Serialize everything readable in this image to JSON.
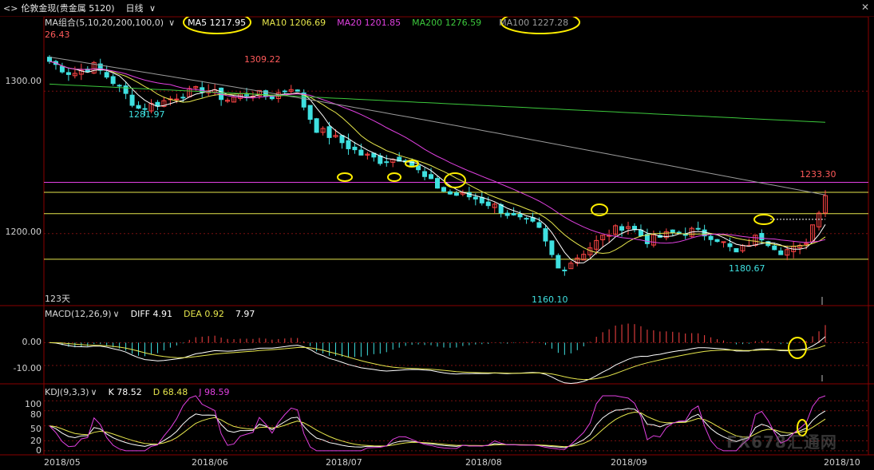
{
  "toolbar": {
    "nav_label": "<>",
    "title": "伦敦金现(贵金属 5120)",
    "period": "日线",
    "close_label": "✕"
  },
  "colors": {
    "background": "#000000",
    "up": "#ff4545",
    "down": "#3fe0e0",
    "ma5": "#ffffff",
    "ma10": "#e6e64c",
    "ma20": "#e040e0",
    "ma100": "#9a9a9a",
    "ma200": "#3cc83c",
    "highlight": "#ffee00",
    "grid": "#7a1010"
  },
  "legends": {
    "main": {
      "label": "MA组合(5,10,20,200,100,0)",
      "ma5": "MA5 1217.95",
      "ma10": "MA10 1206.69",
      "ma20": "MA20 1201.85",
      "ma200": "MA200 1276.59",
      "ma100": "MA100 1227.28"
    },
    "macd": {
      "label": "MACD(12,26,9)",
      "diff": "DIFF 4.91",
      "dea": "DEA 0.92",
      "macd": "7.97"
    },
    "kdj": {
      "label": "KDJ(9,3,3)",
      "k": "K 78.52",
      "d": "D 68.48",
      "j": "J 98.59"
    }
  },
  "annotations": {
    "days": "123天",
    "high_1": "1309.22",
    "low_1": "1281.97",
    "low_2": "1160.10",
    "low_3": "1180.67",
    "high_2": "1233.30",
    "top_left": "26.43"
  },
  "watermark": "FX678汇通网",
  "chart_data": {
    "type": "candlestick",
    "x_ticks": [
      "2018/05",
      "2018/06",
      "2018/07",
      "2018/08",
      "2018/09",
      "2018/10"
    ],
    "price_axis": {
      "ticks": [
        "1300.00",
        "1200.00"
      ],
      "tick_values": [
        1300,
        1200
      ],
      "range": [
        1150,
        1345
      ]
    },
    "horizontal_levels": [
      {
        "value": 1236,
        "color": "#e040e0"
      },
      {
        "value": 1229,
        "color": "#e6e64c"
      },
      {
        "value": 1214,
        "color": "#e6e64c"
      },
      {
        "value": 1182,
        "color": "#e6e64c"
      }
    ],
    "price_anchors": [
      {
        "label": "2018/05",
        "value": 1321
      },
      {
        "label": "2018/05",
        "value": 1312
      },
      {
        "label": "2018/05",
        "value": 1318
      },
      {
        "label": "2018/05",
        "value": 1305
      },
      {
        "label": "2018/05",
        "value": 1288
      },
      {
        "label": "2018/05",
        "value": 1292
      },
      {
        "label": "2018/06",
        "value": 1298
      },
      {
        "label": "2018/06",
        "value": 1302
      },
      {
        "label": "2018/06",
        "value": 1294
      },
      {
        "label": "2018/06",
        "value": 1299
      },
      {
        "label": "2018/06",
        "value": 1296
      },
      {
        "label": "2018/06",
        "value": 1304
      },
      {
        "label": "2018/06",
        "value": 1274
      },
      {
        "label": "2018/07",
        "value": 1266
      },
      {
        "label": "2018/07",
        "value": 1256
      },
      {
        "label": "2018/07",
        "value": 1251
      },
      {
        "label": "2018/07",
        "value": 1254
      },
      {
        "label": "2018/07",
        "value": 1238
      },
      {
        "label": "2018/07",
        "value": 1228
      },
      {
        "label": "2018/08",
        "value": 1226
      },
      {
        "label": "2018/08",
        "value": 1220
      },
      {
        "label": "2018/08",
        "value": 1211
      },
      {
        "label": "2018/08",
        "value": 1205
      },
      {
        "label": "2018/08",
        "value": 1174
      },
      {
        "label": "2018/08",
        "value": 1186
      },
      {
        "label": "2018/09",
        "value": 1198
      },
      {
        "label": "2018/09",
        "value": 1207
      },
      {
        "label": "2018/09",
        "value": 1195
      },
      {
        "label": "2018/09",
        "value": 1200
      },
      {
        "label": "2018/09",
        "value": 1202
      },
      {
        "label": "2018/09",
        "value": 1198
      },
      {
        "label": "2018/09",
        "value": 1186
      },
      {
        "label": "2018/09",
        "value": 1199
      },
      {
        "label": "2018/09",
        "value": 1188
      },
      {
        "label": "2018/10",
        "value": 1190
      },
      {
        "label": "2018/10",
        "value": 1228
      }
    ],
    "macd_axis": {
      "ticks": [
        "0.00",
        "-10.00"
      ],
      "tick_values": [
        0,
        -10
      ],
      "range": [
        -17,
        11
      ]
    },
    "kdj_axis": {
      "ticks": [
        "100",
        "80",
        "50",
        "20",
        "0"
      ],
      "tick_values": [
        100,
        80,
        50,
        20,
        0
      ],
      "range": [
        -5,
        110
      ]
    }
  }
}
